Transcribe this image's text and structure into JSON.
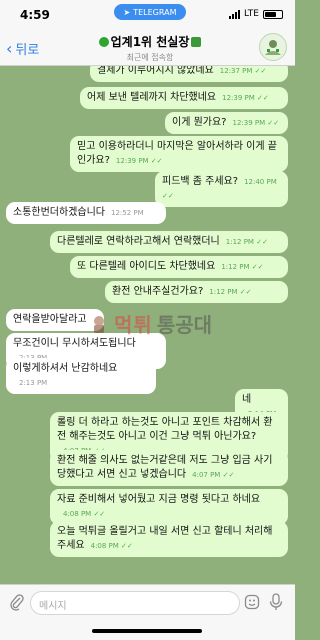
{
  "status_bar": {
    "time": "4:59",
    "pill_label": "TELEGRAM",
    "network": "LTE"
  },
  "header": {
    "back_label": "뒤로",
    "title": "업계1위 천실장",
    "subtitle": "최근에 접속함"
  },
  "messages": [
    {
      "dir": "out",
      "text": "결제가 이루어지지 않았네요",
      "time": "12:37 PM",
      "read": true
    },
    {
      "dir": "out",
      "text": "어제 보낸 텔레까지 차단했네요",
      "time": "12:39 PM",
      "read": true
    },
    {
      "dir": "out",
      "text": "이게 뭔가요?",
      "time": "12:39 PM",
      "read": true
    },
    {
      "dir": "out",
      "text": "믿고 이용하라더니 마지막은 알아서하라 이게 끝인가요?",
      "time": "12:39 PM",
      "read": true
    },
    {
      "dir": "out",
      "text": "피드백 좀 주세요?",
      "time": "12:40 PM",
      "read": true
    },
    {
      "dir": "in",
      "text": "소통한번더하겠습니다",
      "time": "12:52 PM"
    },
    {
      "dir": "out",
      "text": "다른텔레로 연락하라고해서 연락했더니",
      "time": "1:12 PM",
      "read": true
    },
    {
      "dir": "out",
      "text": "또 다른텔레 아이디도 차단했네요",
      "time": "1:12 PM",
      "read": true
    },
    {
      "dir": "out",
      "text": "환전 안내주실건가요?",
      "time": "1:12 PM",
      "read": true
    },
    {
      "dir": "in",
      "text": "연락을받아달라고",
      "time": ""
    },
    {
      "dir": "in",
      "text": "무조건이니 무시하셔도됩니다",
      "time": "2:13 PM"
    },
    {
      "dir": "in",
      "text": "이렇게하셔서 난감하네요",
      "time": "2:13 PM"
    },
    {
      "dir": "out",
      "text": "네",
      "time": "2:14 PM",
      "read": true
    },
    {
      "dir": "out",
      "text": "롤링 더 하라고 하는것도 아니고 포인트 차감해서 환전 해주는것도 아니고 이건 그냥 먹튀 아닌가요?",
      "time": "4:07 PM",
      "read": true
    },
    {
      "dir": "out",
      "text": "환전 해줄 의사도 없는거같은데 저도 그냥 입금 사기 당했다고 서면 신고 넣겠습니다",
      "time": "4:07 PM",
      "read": true
    },
    {
      "dir": "out",
      "text": "자료 준비해서 넣어뒀고 지금 명령 됫다고 하네요",
      "time": "4:08 PM",
      "read": true
    },
    {
      "dir": "out",
      "text": "오늘 먹튀글 올릴거고 내일 서면 신고 할테니 처리해 주세요",
      "time": "4:08 PM",
      "read": true
    }
  ],
  "watermark": {
    "text": "먹튀",
    "text2": "통공대"
  },
  "input": {
    "placeholder": "메시지"
  },
  "colors": {
    "accent": "#2f7fe6",
    "outgoing_bubble": "#e2fbcf",
    "incoming_bubble": "#ffffff",
    "chat_background": "#8fb07a"
  }
}
